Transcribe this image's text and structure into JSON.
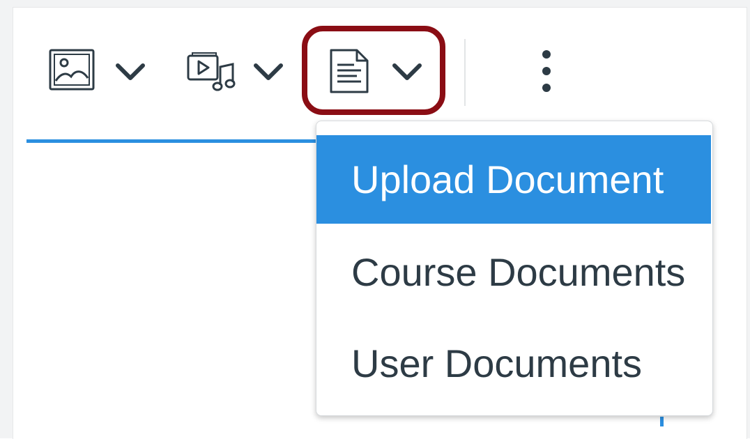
{
  "toolbar": {
    "image_button": {
      "icon": "image-icon",
      "dropdown_icon": "chevron-down-icon"
    },
    "media_button": {
      "icon": "media-icon",
      "dropdown_icon": "chevron-down-icon"
    },
    "document_button": {
      "icon": "document-icon",
      "dropdown_icon": "chevron-down-icon",
      "highlighted": true
    },
    "more_button": {
      "icon": "more-vertical-icon"
    }
  },
  "document_menu": {
    "items": [
      {
        "label": "Upload Document",
        "active": true
      },
      {
        "label": "Course Documents",
        "active": false
      },
      {
        "label": "User Documents",
        "active": false
      }
    ]
  },
  "colors": {
    "accent": "#2b8fe0",
    "highlight_border": "#8a0d14",
    "text": "#2d3b45"
  }
}
